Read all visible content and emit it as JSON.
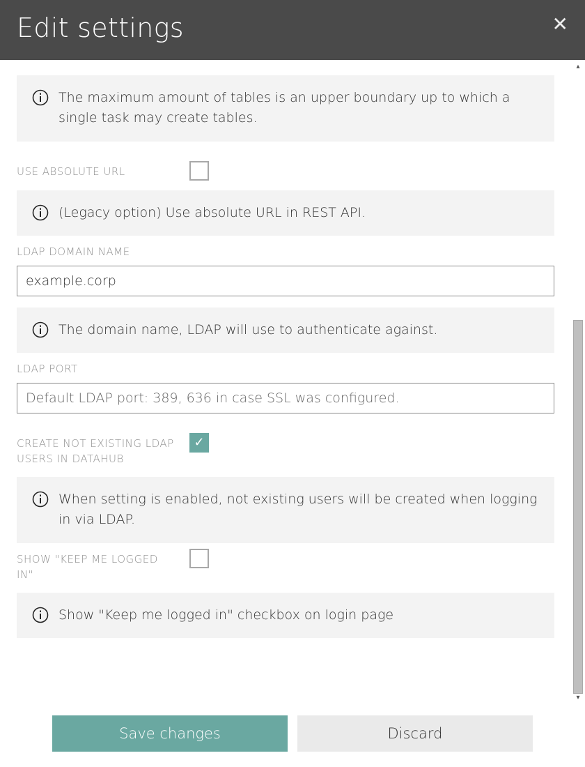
{
  "header": {
    "title": "Edit settings"
  },
  "sections": {
    "maxTables": {
      "info": "The maximum amount of tables is an upper boundary up to which a single task may create tables."
    },
    "useAbsoluteUrl": {
      "label": "USE ABSOLUTE URL",
      "checked": false,
      "info": "(Legacy option) Use absolute URL in REST API."
    },
    "ldapDomain": {
      "label": "LDAP DOMAIN NAME",
      "value": "example.corp",
      "info": "The domain name, LDAP will use to authenticate against."
    },
    "ldapPort": {
      "label": "LDAP PORT",
      "placeholder": "Default LDAP port: 389, 636 in case SSL was configured.",
      "value": ""
    },
    "createUsers": {
      "label": "CREATE NOT EXISTING LDAP USERS IN DATAHUB",
      "checked": true,
      "info": "When setting is enabled, not existing users will be created when logging in via LDAP."
    },
    "keepLoggedIn": {
      "label": "SHOW \"KEEP ME LOGGED IN\"",
      "checked": false,
      "info": "Show \"Keep me logged in\" checkbox on login page"
    }
  },
  "footer": {
    "save": "Save changes",
    "discard": "Discard"
  }
}
